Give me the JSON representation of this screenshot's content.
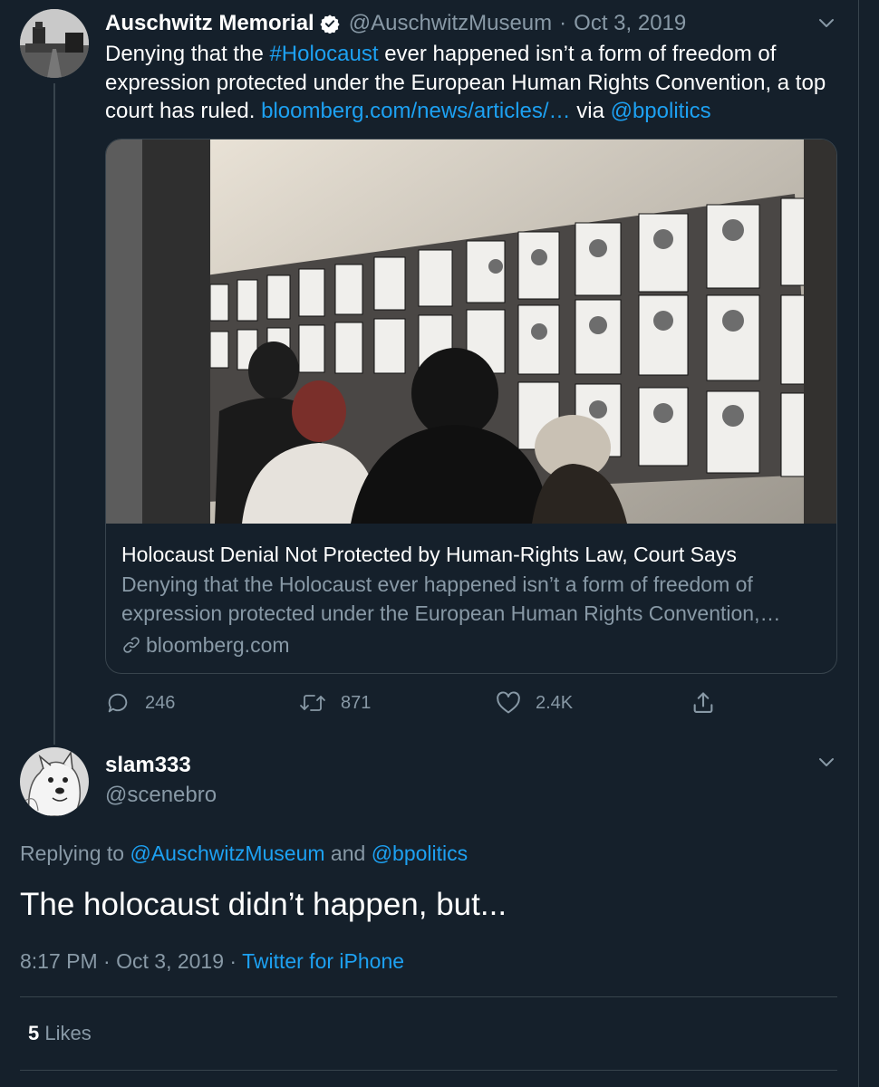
{
  "parent_tweet": {
    "display_name": "Auschwitz Memorial",
    "handle": "@AuschwitzMuseum",
    "separator": "·",
    "date": "Oct 3, 2019",
    "text_segments": [
      "Denying that the ",
      "#Holocaust",
      " ever happened isn’t a form of freedom of expression protected under the European Human Rights Convention, a top court has ruled. ",
      "bloomberg.com/news/articles/…",
      " via ",
      "@bpolitics"
    ],
    "card": {
      "title": "Holocaust Denial Not Protected by Human-Rights Law, Court Says",
      "description": "Denying that the Holocaust ever happened isn’t a form of freedom of expression protected under the European Human Rights Convention,…",
      "domain": "bloomberg.com"
    },
    "actions": {
      "reply_count": "246",
      "retweet_count": "871",
      "like_count": "2.4K"
    }
  },
  "reply_tweet": {
    "display_name": "slam333",
    "handle": "@scenebro",
    "replying_prefix": "Replying to ",
    "replying_handle_1": "@AuschwitzMuseum",
    "replying_and": " and ",
    "replying_handle_2": "@bpolitics",
    "text": "The holocaust didn’t happen, but...",
    "time": "8:17 PM",
    "separator": " · ",
    "date": "Oct 3, 2019",
    "source": "Twitter for iPhone",
    "likes_count": "5",
    "likes_label": "Likes"
  },
  "icons": {
    "verified": "verified-badge-icon",
    "caret": "chevron-down-icon",
    "reply": "speech-bubble-icon",
    "retweet": "retweet-arrows-icon",
    "like": "heart-icon",
    "share": "share-upload-icon",
    "link": "chain-link-icon"
  },
  "colors": {
    "background": "#15202b",
    "border": "#38444d",
    "secondary_text": "#8899a6",
    "accent_link": "#1da1f2",
    "primary_text": "#ffffff"
  }
}
